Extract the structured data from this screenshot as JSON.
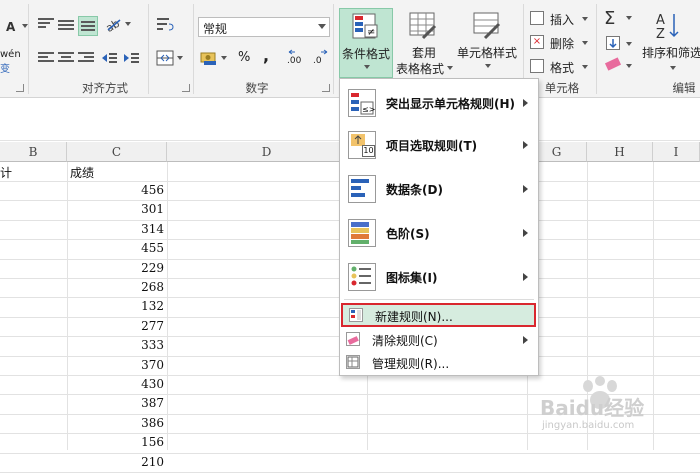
{
  "ribbon": {
    "alignment_group_label": "对齐方式",
    "number_group_label": "数字",
    "number_format_value": "常规",
    "number_symbols": [
      "%",
      ","
    ],
    "decimal_buttons": [
      ".00",
      ".0"
    ],
    "conditional_format_label": "条件格式",
    "table_format_label_1": "套用",
    "table_format_label_2": "表格格式",
    "cell_styles_label": "单元格样式",
    "cells_group_label": "单元格",
    "insert_label": "插入",
    "delete_label": "删除",
    "format_label": "格式",
    "sort_filter_label": "排序和筛选",
    "edit_group_label": "编辑",
    "left_partial_a": "A",
    "left_partial_wen": "wén",
    "left_partial_bian": "变"
  },
  "grid": {
    "columns": [
      "B",
      "C",
      "D",
      "G",
      "H",
      "I"
    ],
    "b_partial": "计",
    "c_header": "成绩",
    "values": [
      "456",
      "301",
      "314",
      "455",
      "229",
      "268",
      "132",
      "277",
      "333",
      "370",
      "430",
      "387",
      "386",
      "156",
      "210"
    ]
  },
  "menu": {
    "items": [
      {
        "label": "突出显示单元格规则(H)",
        "has_sub": true
      },
      {
        "label": "项目选取规则(T)",
        "has_sub": true
      },
      {
        "label": "数据条(D)",
        "has_sub": true
      },
      {
        "label": "色阶(S)",
        "has_sub": true
      },
      {
        "label": "图标集(I)",
        "has_sub": true
      }
    ],
    "small_items": [
      {
        "label": "新建规则(N)...",
        "has_sub": false
      },
      {
        "label": "清除规则(C)",
        "has_sub": true
      },
      {
        "label": "管理规则(R)...",
        "has_sub": false
      }
    ],
    "icon_topn_text": "10"
  },
  "watermark": {
    "brand": "Baidu经验",
    "url": "jingyan.baidu.com"
  }
}
